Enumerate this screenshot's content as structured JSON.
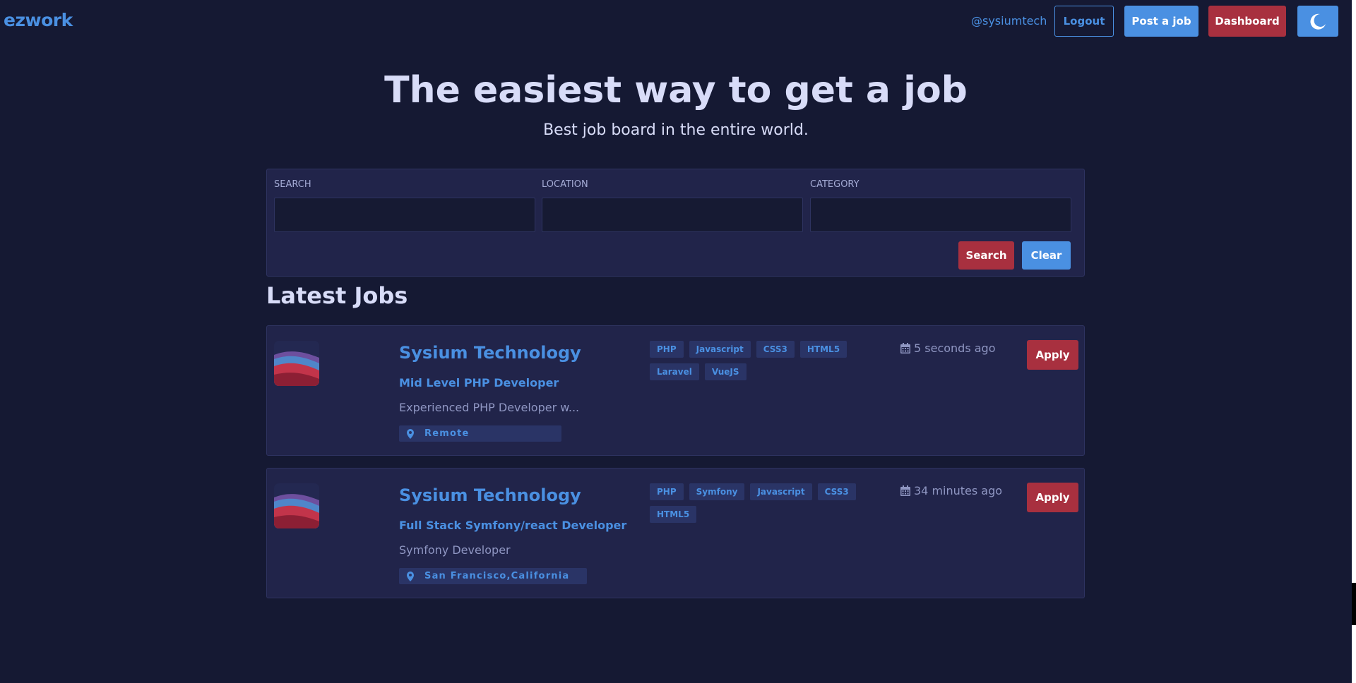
{
  "nav": {
    "brand": "ezwork",
    "user": "@sysiumtech",
    "logout_label": "Logout",
    "post_label": "Post a job",
    "dashboard_label": "Dashboard",
    "theme_icon": "moon-icon"
  },
  "hero": {
    "title": "The easiest way to get a job",
    "subtitle": "Best job board in the entire world."
  },
  "search": {
    "fields": [
      {
        "label": "SEARCH",
        "value": ""
      },
      {
        "label": "LOCATION",
        "value": ""
      },
      {
        "label": "CATEGORY",
        "value": ""
      }
    ],
    "search_label": "Search",
    "clear_label": "Clear"
  },
  "section_title": "Latest Jobs",
  "jobs": [
    {
      "company": "Sysium Technology",
      "position": "Mid Level PHP Developer",
      "description": "Experienced PHP Developer w...",
      "location": "Remote",
      "tags": [
        "PHP",
        "Javascript",
        "CSS3",
        "HTML5",
        "Laravel",
        "VueJS"
      ],
      "posted": "5 seconds ago",
      "apply_label": "Apply"
    },
    {
      "company": "Sysium Technology",
      "position": "Full Stack Symfony/react Developer",
      "description": "Symfony Developer",
      "location": "San Francisco,California",
      "tags": [
        "PHP",
        "Symfony",
        "Javascript",
        "CSS3",
        "HTML5"
      ],
      "posted": "34 minutes ago",
      "apply_label": "Apply"
    }
  ],
  "colors": {
    "background": "#151933",
    "panel": "#21244a",
    "accent_blue": "#4a90e2",
    "accent_red": "#a8303f",
    "heading_text": "#d8dcf8",
    "muted_text": "#8f96c2"
  }
}
